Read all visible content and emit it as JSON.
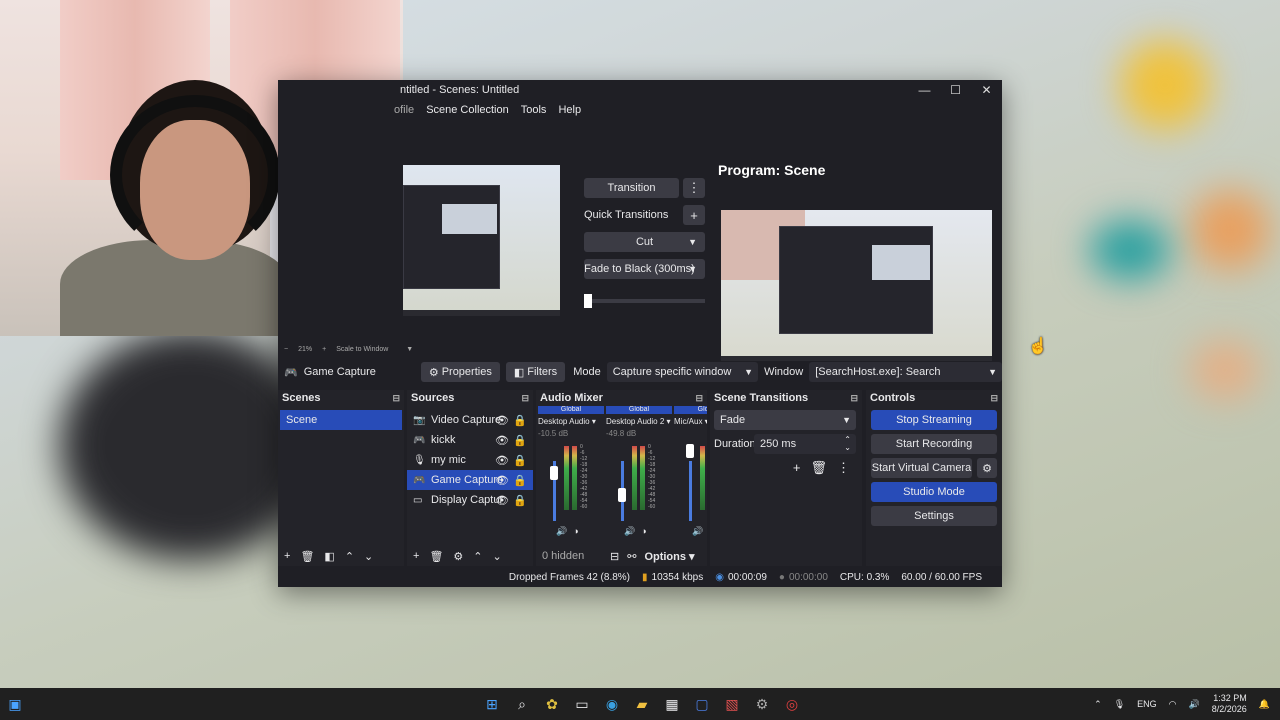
{
  "window": {
    "title": "ntitled - Scenes: Untitled",
    "controls": [
      "—",
      "☐",
      "✕"
    ]
  },
  "menu": [
    "ofile",
    "Scene Collection",
    "Tools",
    "Help"
  ],
  "program_label": "Program: Scene",
  "transition_panel": {
    "transition_btn": "Transition",
    "quick_transitions": "Quick Transitions",
    "cut": "Cut",
    "fade_black": "Fade to Black (300ms)"
  },
  "zoom": {
    "level": "21%",
    "minus": "−",
    "plus": "+",
    "scale": "Scale to Window"
  },
  "source_toolbar": {
    "source_name": "Game Capture",
    "properties": "Properties",
    "filters": "Filters",
    "mode_label": "Mode",
    "mode_value": "Capture specific window",
    "window_label": "Window",
    "window_value": "[SearchHost.exe]: Search"
  },
  "scenes": {
    "title": "Scenes",
    "items": [
      "Scene"
    ]
  },
  "sources": {
    "title": "Sources",
    "items": [
      {
        "label": "Video Capture D",
        "icon": "camera-icon"
      },
      {
        "label": "kickk",
        "icon": "gamepad-icon"
      },
      {
        "label": "my mic",
        "icon": "mic-icon"
      },
      {
        "label": "Game Capture",
        "icon": "gamepad-icon",
        "selected": true
      },
      {
        "label": "Display Capture",
        "icon": "monitor-icon"
      }
    ]
  },
  "mixer": {
    "title": "Audio Mixer",
    "channels": [
      {
        "tag": "Global",
        "name": "Desktop Audio",
        "db": "-10.5 dB"
      },
      {
        "tag": "Global",
        "name": "Desktop Audio 2",
        "db": "-49.8 dB"
      },
      {
        "tag": "Globa",
        "name": "Mic/Aux",
        "db": ""
      }
    ],
    "scale": [
      "0",
      "-6",
      "-12",
      "-18",
      "-24",
      "-30",
      "-36",
      "-42",
      "-48",
      "-54",
      "-60"
    ],
    "hidden": "0 hidden",
    "options": "Options"
  },
  "scene_transitions": {
    "title": "Scene Transitions",
    "value": "Fade",
    "duration_label": "Duration",
    "duration_value": "250 ms"
  },
  "controls": {
    "title": "Controls",
    "stop_streaming": "Stop Streaming",
    "start_recording": "Start Recording",
    "start_virtual_camera": "Start Virtual Camera",
    "studio_mode": "Studio Mode",
    "settings": "Settings"
  },
  "status": {
    "dropped": "Dropped Frames 42 (8.8%)",
    "kbps": "10354 kbps",
    "stream_time": "00:00:09",
    "rec_time": "00:00:00",
    "cpu": "CPU: 0.3%",
    "fps": "60.00 / 60.00 FPS"
  },
  "taskbar": {
    "lang": "ENG",
    "time": "1:32 PM",
    "date": "8/2/2026"
  },
  "colors": {
    "accent": "#284cb8",
    "panel": "#232329",
    "window_bg": "#1f1f25"
  }
}
